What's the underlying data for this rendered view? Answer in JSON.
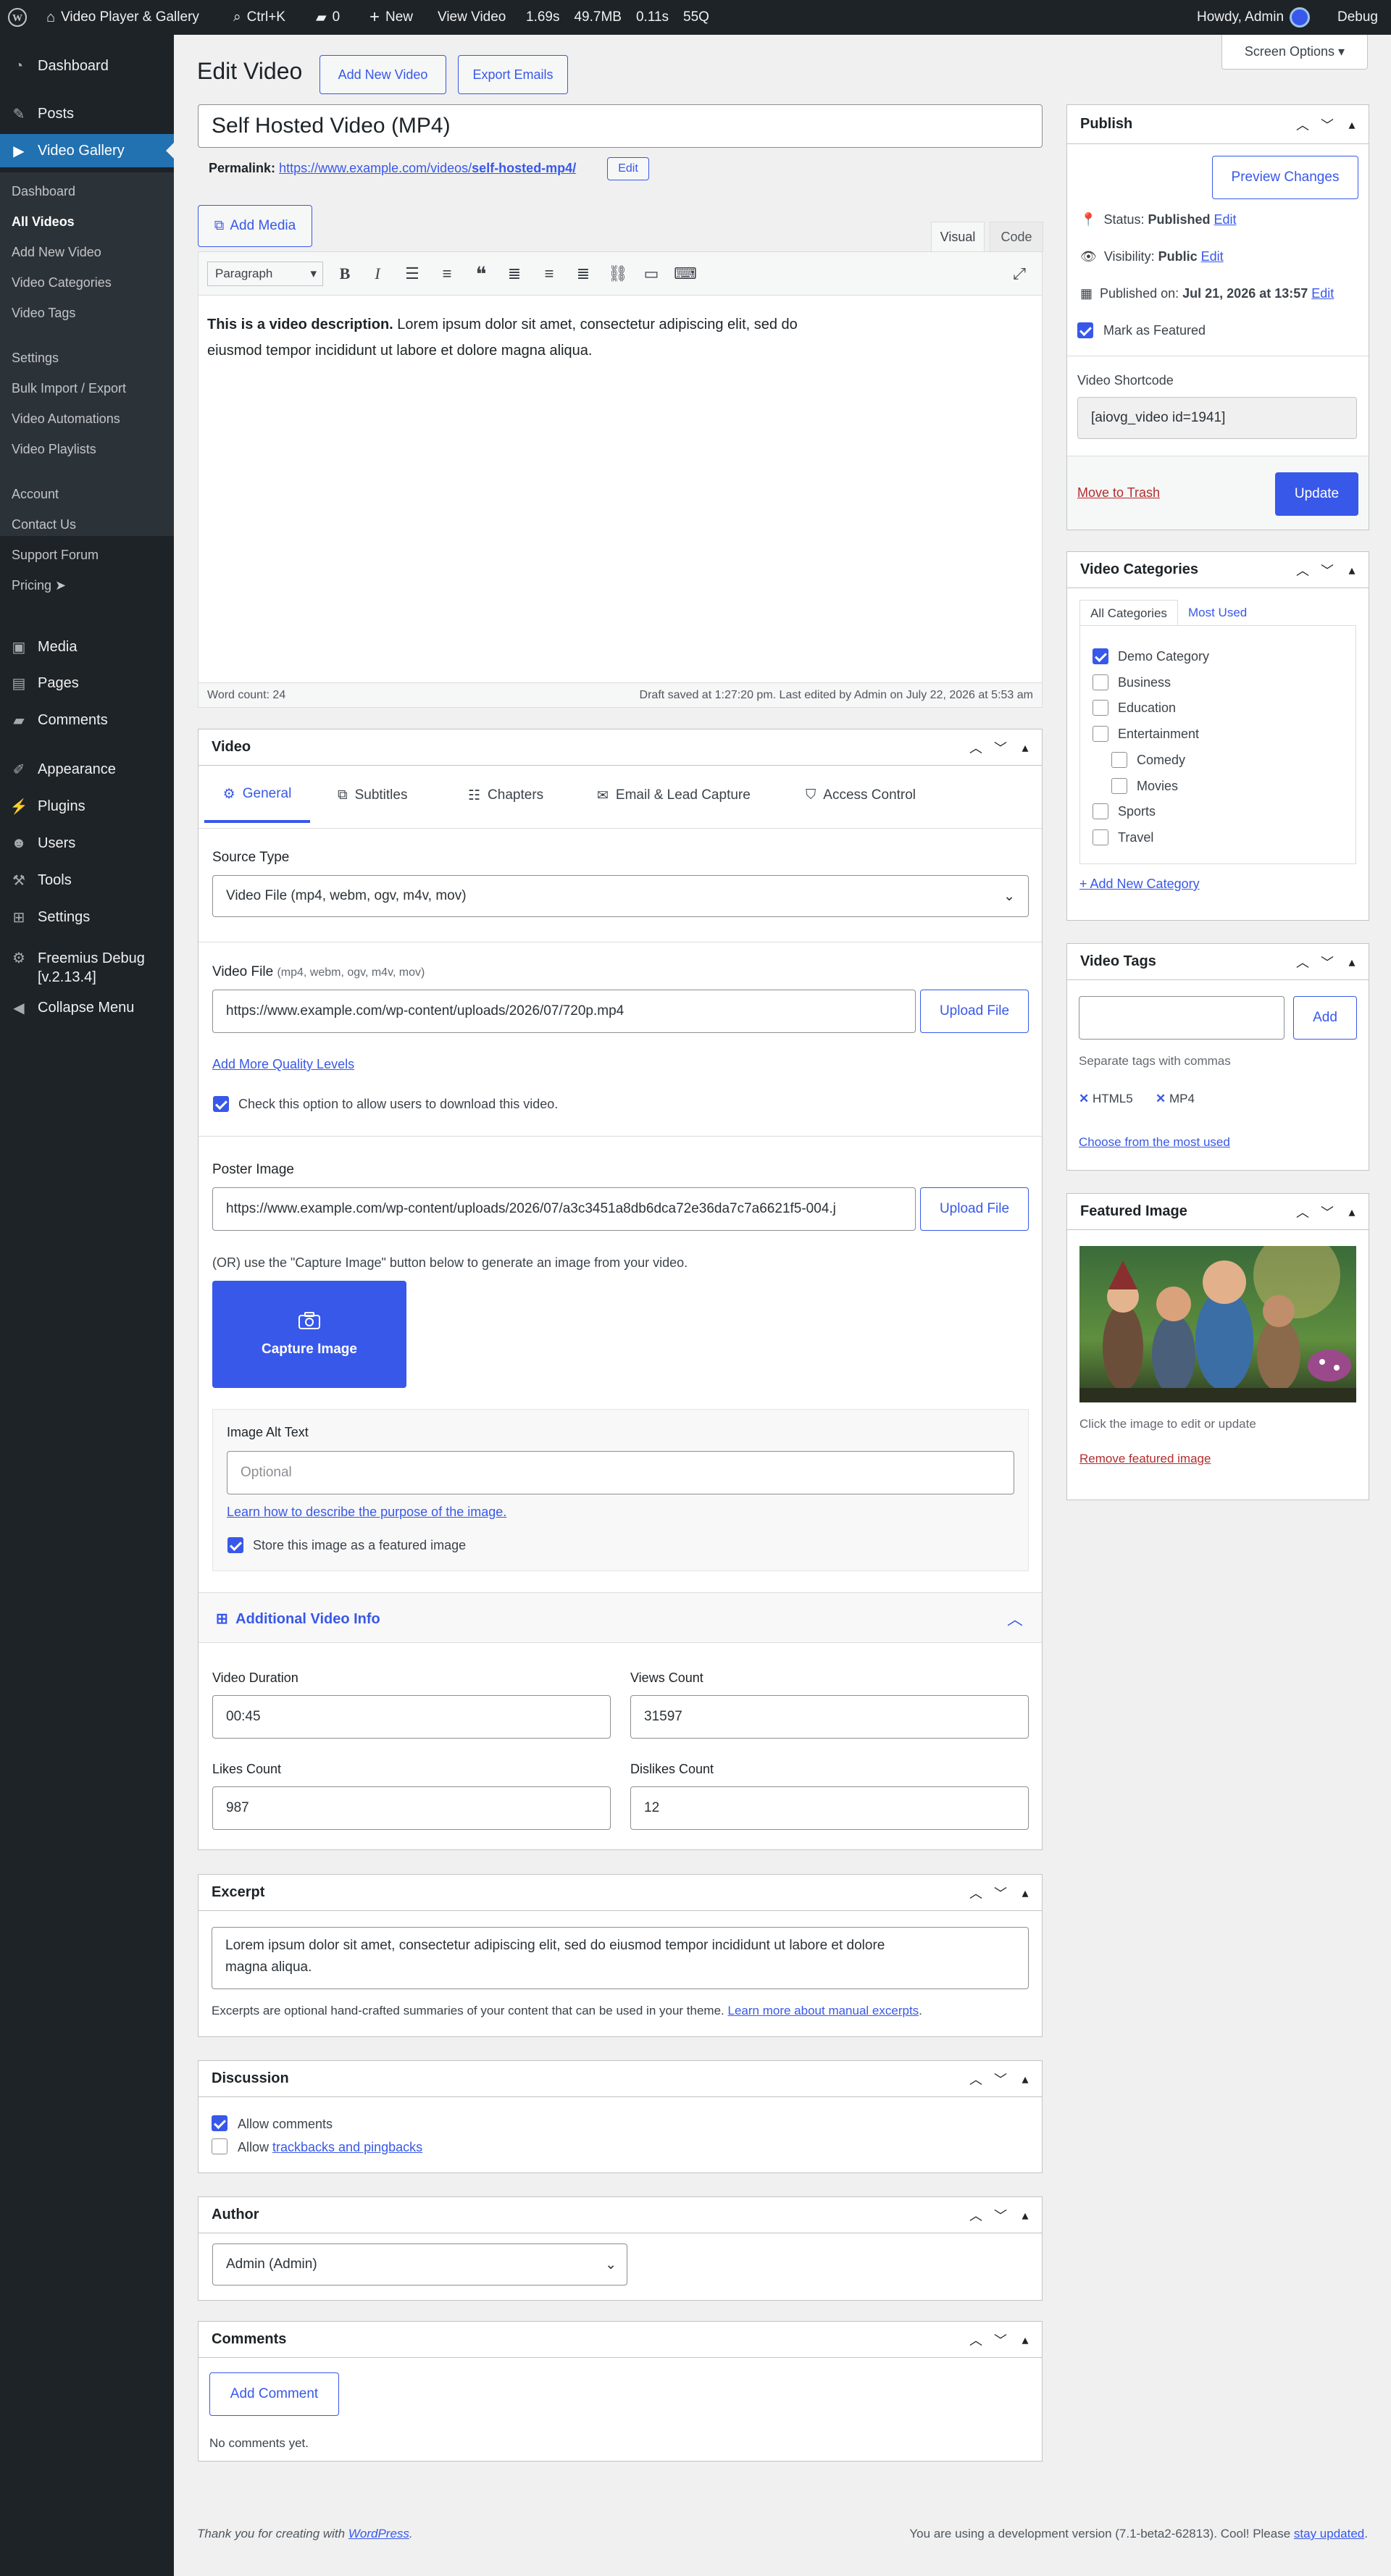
{
  "adminbar": {
    "site": "Video Player & Gallery",
    "shortcut": "Ctrl+K",
    "comments": "0",
    "new": "New",
    "view": "View Video",
    "stats": [
      "1.69s",
      "49.7MB",
      "0.11s",
      "55Q"
    ],
    "howdy": "Howdy, Admin",
    "debug": "Debug"
  },
  "screen_options": "Screen Options",
  "sidebar": {
    "dashboard": "Dashboard",
    "posts": "Posts",
    "video_gallery": "Video Gallery",
    "sub": [
      "Dashboard",
      "All Videos",
      "Add New Video",
      "Video Categories",
      "Video Tags",
      "Settings",
      "Bulk Import / Export",
      "Video Automations",
      "Video Playlists",
      "Account",
      "Contact Us",
      "Support Forum",
      "Pricing"
    ],
    "media": "Media",
    "pages": "Pages",
    "comments": "Comments",
    "appearance": "Appearance",
    "plugins": "Plugins",
    "users": "Users",
    "tools": "Tools",
    "settings": "Settings",
    "freemius": "Freemius Debug",
    "freemius_ver": "[v.2.13.4]",
    "collapse": "Collapse Menu"
  },
  "header": {
    "title": "Edit Video",
    "add_new": "Add New Video",
    "export": "Export Emails"
  },
  "post": {
    "title": "Self Hosted Video (MP4)",
    "permalink_label": "Permalink:",
    "permalink_base": "https://www.example.com/videos/",
    "permalink_slug": "self-hosted-mp4/",
    "permalink_edit": "Edit"
  },
  "editor": {
    "add_media": "Add Media",
    "tab_visual": "Visual",
    "tab_code": "Code",
    "format": "Paragraph",
    "content_bold": "This is a video description.",
    "content_line1": " Lorem ipsum dolor sit amet, consectetur adipiscing elit, sed do",
    "content_line2": "eiusmod tempor incididunt ut labore et dolore magna aliqua.",
    "word_count": "Word count: 24",
    "draft_saved": "Draft saved at 1:27:20 pm. Last edited by Admin on July 22, 2026 at 5:53 am"
  },
  "video": {
    "title": "Video",
    "tabs": [
      "General",
      "Subtitles",
      "Chapters",
      "Email & Lead Capture",
      "Access Control"
    ],
    "source_type_label": "Source Type",
    "source_type_value": "Video File (mp4, webm, ogv, m4v, mov)",
    "video_file_label": "Video File",
    "video_file_hint": "(mp4, webm, ogv, m4v, mov)",
    "video_file_value": "https://www.example.com/wp-content/uploads/2026/07/720p.mp4",
    "upload": "Upload File",
    "add_quality": "Add More Quality Levels",
    "download_opt": "Check this option to allow users to download this video.",
    "poster_label": "Poster Image",
    "poster_value": "https://www.example.com/wp-content/uploads/2026/07/a3c3451a8db6dca72e36da7c7a6621f5-004.j",
    "capture_hint": "(OR) use the \"Capture Image\" button below to generate an image from your video.",
    "capture": "Capture Image",
    "alt_label": "Image Alt Text",
    "alt_placeholder": "Optional",
    "alt_learn": "Learn how to describe the purpose of the image.",
    "store_featured": "Store this image as a featured image",
    "additional": "Additional Video Info",
    "duration_label": "Video Duration",
    "duration": "00:45",
    "views_label": "Views Count",
    "views": "31597",
    "likes_label": "Likes Count",
    "likes": "987",
    "dislikes_label": "Dislikes Count",
    "dislikes": "12"
  },
  "excerpt": {
    "title": "Excerpt",
    "text1": "Lorem ipsum dolor sit amet, consectetur adipiscing elit, sed do eiusmod tempor incididunt ut labore et dolore",
    "text2": "magna aliqua.",
    "help": "Excerpts are optional hand-crafted summaries of your content that can be used in your theme.",
    "help_link": "Learn more about manual excerpts",
    "help_end": "."
  },
  "discussion": {
    "title": "Discussion",
    "allow_comments": "Allow comments",
    "allow_prefix": "Allow ",
    "trackbacks": "trackbacks and pingbacks"
  },
  "author": {
    "title": "Author",
    "value": "Admin (Admin)"
  },
  "comments_box": {
    "title": "Comments",
    "add": "Add Comment",
    "none": "No comments yet."
  },
  "publish": {
    "title": "Publish",
    "preview": "Preview Changes",
    "status_label": "Status:",
    "status": "Published",
    "visibility_label": "Visibility:",
    "visibility": "Public",
    "published_label": "Published on:",
    "published": "Jul 21, 2026 at 13:57",
    "edit": "Edit",
    "featured": "Mark as Featured",
    "shortcode_label": "Video Shortcode",
    "shortcode": "[aiovg_video id=1941]",
    "trash": "Move to Trash",
    "update": "Update"
  },
  "categories": {
    "title": "Video Categories",
    "tab_all": "All Categories",
    "tab_used": "Most Used",
    "items": [
      "Demo Category",
      "Business",
      "Education",
      "Entertainment",
      "Comedy",
      "Movies",
      "Sports",
      "Travel"
    ],
    "add_new": "+ Add New Category"
  },
  "tags": {
    "title": "Video Tags",
    "add": "Add",
    "help": "Separate tags with commas",
    "items": [
      "HTML5",
      "MP4"
    ],
    "choose": "Choose from the most used"
  },
  "featured_image": {
    "title": "Featured Image",
    "help": "Click the image to edit or update",
    "remove": "Remove featured image"
  },
  "footer": {
    "thanks": "Thank you for creating with ",
    "wp": "WordPress",
    "thanks_end": ".",
    "version": "You are using a development version (7.1-beta2-62813). Cool! Please ",
    "stay": "stay updated",
    "version_end": "."
  },
  "colors": {
    "accent": "#3858e9",
    "sidebar": "#1d2327",
    "active": "#2271b1",
    "trash": "#b32d2e"
  }
}
